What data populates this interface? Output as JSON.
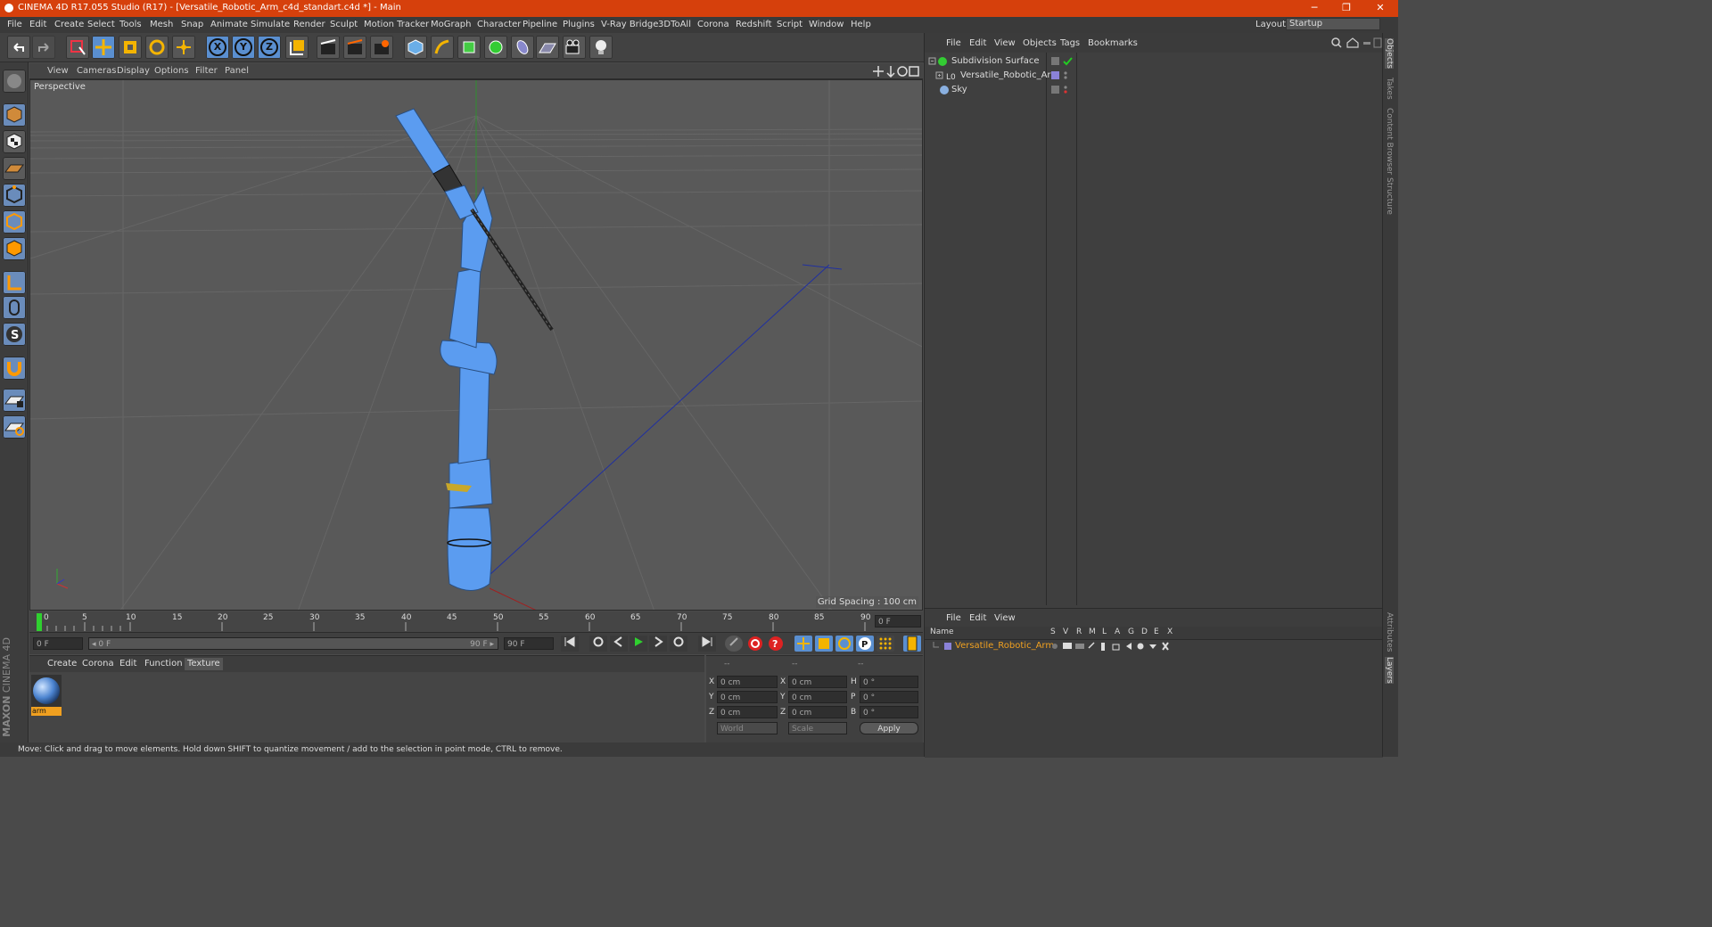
{
  "window": {
    "title": "CINEMA 4D R17.055 Studio (R17) - [Versatile_Robotic_Arm_c4d_standart.c4d *] - Main",
    "minimize": "─",
    "maximize": "❐",
    "close": "✕"
  },
  "menu": [
    "File",
    "Edit",
    "Create",
    "Select",
    "Tools",
    "Mesh",
    "Snap",
    "Animate",
    "Simulate",
    "Render",
    "Sculpt",
    "Motion Tracker",
    "MoGraph",
    "Character",
    "Pipeline",
    "Plugins",
    "V-Ray Bridge",
    "3DToAll",
    "Corona",
    "Redshift",
    "Script",
    "Window",
    "Help"
  ],
  "layout": {
    "label": "Layout:",
    "value": "Startup"
  },
  "toolbar": {
    "x": "X",
    "y": "Y",
    "z": "Z"
  },
  "viewport": {
    "menu": [
      "View",
      "Cameras",
      "Display",
      "Options",
      "Filter",
      "Panel"
    ],
    "label": "Perspective",
    "grid_spacing": "Grid Spacing : 100 cm"
  },
  "timeline": {
    "ticks": [
      "0",
      "5",
      "10",
      "15",
      "20",
      "25",
      "30",
      "35",
      "40",
      "45",
      "50",
      "55",
      "60",
      "65",
      "70",
      "75",
      "80",
      "85",
      "90"
    ],
    "current_frame": "0 F"
  },
  "time_controls": {
    "start": "0 F",
    "slider_start": "◂ 0 F",
    "slider_end": "90 F ▸",
    "end": "90 F"
  },
  "material_panel": {
    "menu": [
      "Create",
      "Corona",
      "Edit",
      "Function",
      "Texture"
    ],
    "material_name": "arm"
  },
  "coords": {
    "headers": [
      "--",
      "--",
      "--"
    ],
    "rows": [
      {
        "a": "X",
        "av": "0 cm",
        "b": "X",
        "bv": "0 cm",
        "c": "H",
        "cv": "0 °"
      },
      {
        "a": "Y",
        "av": "0 cm",
        "b": "Y",
        "bv": "0 cm",
        "c": "P",
        "cv": "0 °"
      },
      {
        "a": "Z",
        "av": "0 cm",
        "b": "Z",
        "bv": "0 cm",
        "c": "B",
        "cv": "0 °"
      }
    ],
    "mode": "World",
    "scale": "Scale",
    "apply": "Apply"
  },
  "status": "Move: Click and drag to move elements. Hold down SHIFT to quantize movement / add to the selection in point mode, CTRL to remove.",
  "objects_panel": {
    "menu": [
      "File",
      "Edit",
      "View",
      "Objects",
      "Tags",
      "Bookmarks"
    ],
    "items": [
      "Subdivision Surface",
      "Versatile_Robotic_Arm",
      "Sky"
    ]
  },
  "layers_panel": {
    "menu": [
      "File",
      "Edit",
      "View"
    ],
    "name_header": "Name",
    "columns": [
      "S",
      "V",
      "R",
      "M",
      "L",
      "A",
      "G",
      "D",
      "E",
      "X"
    ],
    "layer": "Versatile_Robotic_Arm"
  },
  "side_tabs": [
    "Objects",
    "Takes",
    "Content Browser",
    "Structure",
    "Attributes",
    "Layers"
  ],
  "branding": {
    "maxon": "MAXON",
    "product": "CINEMA 4D"
  },
  "colors": {
    "titlebar": "#d6400c",
    "accent_blue": "#5a8fd0",
    "arm": "#5b9cf0",
    "layer_orange": "#f0a020"
  }
}
